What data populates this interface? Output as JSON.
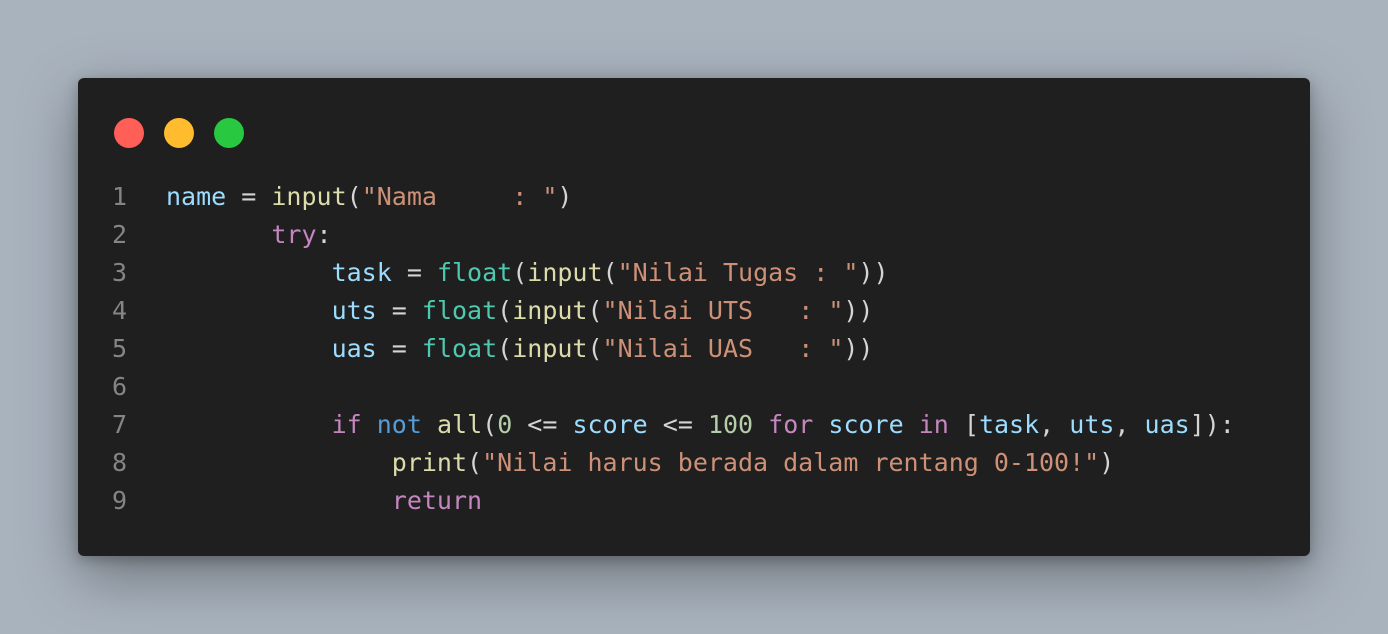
{
  "theme": {
    "background": "#a9b3be",
    "window": "#1f1f1f",
    "dot_colors": [
      "#ff5f57",
      "#febc2e",
      "#28c840"
    ]
  },
  "window_controls": [
    "close",
    "minimize",
    "maximize"
  ],
  "code": {
    "lines": [
      {
        "number": "1",
        "tokens": [
          {
            "text": "name",
            "kind": "var"
          },
          {
            "text": " = ",
            "kind": "op"
          },
          {
            "text": "input",
            "kind": "fn"
          },
          {
            "text": "(",
            "kind": "punc"
          },
          {
            "text": "\"Nama     : \"",
            "kind": "str"
          },
          {
            "text": ")",
            "kind": "punc"
          }
        ]
      },
      {
        "number": "2",
        "tokens": [
          {
            "text": "       ",
            "kind": "op"
          },
          {
            "text": "try",
            "kind": "ctl"
          },
          {
            "text": ":",
            "kind": "punc"
          }
        ]
      },
      {
        "number": "3",
        "tokens": [
          {
            "text": "           ",
            "kind": "op"
          },
          {
            "text": "task",
            "kind": "var"
          },
          {
            "text": " = ",
            "kind": "op"
          },
          {
            "text": "float",
            "kind": "builtin"
          },
          {
            "text": "(",
            "kind": "punc"
          },
          {
            "text": "input",
            "kind": "fn"
          },
          {
            "text": "(",
            "kind": "punc"
          },
          {
            "text": "\"Nilai Tugas : \"",
            "kind": "str"
          },
          {
            "text": "))",
            "kind": "punc"
          }
        ]
      },
      {
        "number": "4",
        "tokens": [
          {
            "text": "           ",
            "kind": "op"
          },
          {
            "text": "uts",
            "kind": "var"
          },
          {
            "text": " = ",
            "kind": "op"
          },
          {
            "text": "float",
            "kind": "builtin"
          },
          {
            "text": "(",
            "kind": "punc"
          },
          {
            "text": "input",
            "kind": "fn"
          },
          {
            "text": "(",
            "kind": "punc"
          },
          {
            "text": "\"Nilai UTS   : \"",
            "kind": "str"
          },
          {
            "text": "))",
            "kind": "punc"
          }
        ]
      },
      {
        "number": "5",
        "tokens": [
          {
            "text": "           ",
            "kind": "op"
          },
          {
            "text": "uas",
            "kind": "var"
          },
          {
            "text": " = ",
            "kind": "op"
          },
          {
            "text": "float",
            "kind": "builtin"
          },
          {
            "text": "(",
            "kind": "punc"
          },
          {
            "text": "input",
            "kind": "fn"
          },
          {
            "text": "(",
            "kind": "punc"
          },
          {
            "text": "\"Nilai UAS   : \"",
            "kind": "str"
          },
          {
            "text": "))",
            "kind": "punc"
          }
        ]
      },
      {
        "number": "6",
        "tokens": []
      },
      {
        "number": "7",
        "tokens": [
          {
            "text": "           ",
            "kind": "op"
          },
          {
            "text": "if",
            "kind": "ctl"
          },
          {
            "text": " ",
            "kind": "op"
          },
          {
            "text": "not",
            "kind": "kw"
          },
          {
            "text": " ",
            "kind": "op"
          },
          {
            "text": "all",
            "kind": "fn"
          },
          {
            "text": "(",
            "kind": "punc"
          },
          {
            "text": "0",
            "kind": "num"
          },
          {
            "text": " <= ",
            "kind": "op"
          },
          {
            "text": "score",
            "kind": "var"
          },
          {
            "text": " <= ",
            "kind": "op"
          },
          {
            "text": "100",
            "kind": "num"
          },
          {
            "text": " ",
            "kind": "op"
          },
          {
            "text": "for",
            "kind": "ctl"
          },
          {
            "text": " ",
            "kind": "op"
          },
          {
            "text": "score",
            "kind": "var"
          },
          {
            "text": " ",
            "kind": "op"
          },
          {
            "text": "in",
            "kind": "ctl"
          },
          {
            "text": " [",
            "kind": "punc"
          },
          {
            "text": "task",
            "kind": "var"
          },
          {
            "text": ", ",
            "kind": "punc"
          },
          {
            "text": "uts",
            "kind": "var"
          },
          {
            "text": ", ",
            "kind": "punc"
          },
          {
            "text": "uas",
            "kind": "var"
          },
          {
            "text": "]):",
            "kind": "punc"
          }
        ]
      },
      {
        "number": "8",
        "tokens": [
          {
            "text": "               ",
            "kind": "op"
          },
          {
            "text": "print",
            "kind": "fn"
          },
          {
            "text": "(",
            "kind": "punc"
          },
          {
            "text": "\"Nilai harus berada dalam rentang 0-100!\"",
            "kind": "str"
          },
          {
            "text": ")",
            "kind": "punc"
          }
        ]
      },
      {
        "number": "9",
        "tokens": [
          {
            "text": "               ",
            "kind": "op"
          },
          {
            "text": "return",
            "kind": "ctl"
          }
        ]
      }
    ]
  }
}
